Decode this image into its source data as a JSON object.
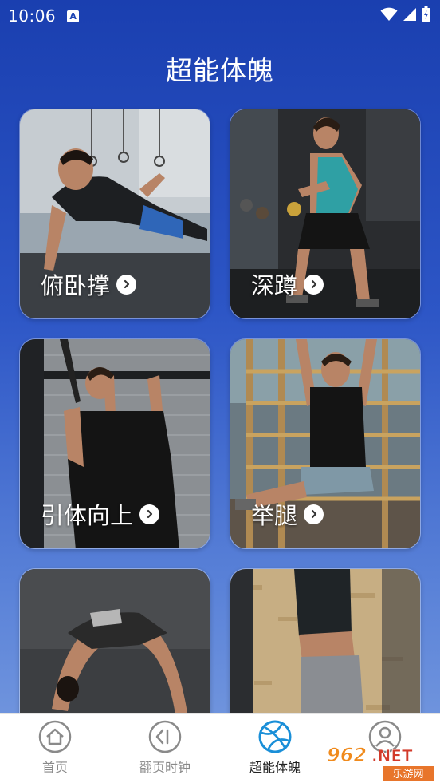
{
  "status_bar": {
    "time": "10:06",
    "notification_icon": "A"
  },
  "page": {
    "title": "超能体魄"
  },
  "cards": [
    {
      "label": "俯卧撑"
    },
    {
      "label": "深蹲"
    },
    {
      "label": "引体向上"
    },
    {
      "label": "举腿"
    },
    {
      "label": ""
    },
    {
      "label": ""
    }
  ],
  "nav": {
    "items": [
      {
        "label": "首页",
        "icon": "home-icon"
      },
      {
        "label": "翻页时钟",
        "icon": "clock-back-icon"
      },
      {
        "label": "超能体魄",
        "icon": "ball-icon",
        "active": true
      },
      {
        "label": "",
        "icon": "profile-icon"
      }
    ]
  },
  "watermark": {
    "text": "962.NET",
    "subtext": "乐游网"
  },
  "colors": {
    "accent": "#1a8fd8",
    "background_top": "#1a3fb0",
    "background_bottom": "#7a9de0"
  }
}
